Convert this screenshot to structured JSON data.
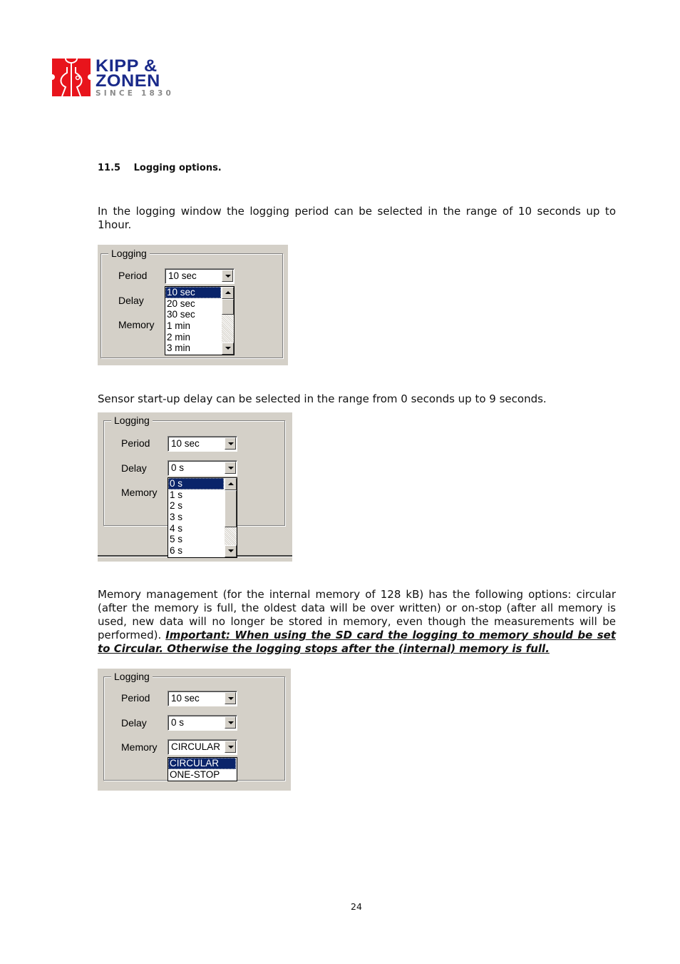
{
  "logo": {
    "line1": "KIPP &",
    "line2": "ZONEN",
    "line3": "SINCE 1830",
    "brand_red": "#e8141c",
    "brand_blue": "#1a2a8a"
  },
  "section": {
    "number": "11.5",
    "title": "Logging options."
  },
  "paragraphs": {
    "period_text": "In the logging window the logging period can be selected in the range of 10 seconds up to 1hour.",
    "delay_text": "Sensor start-up delay can be selected in the range from 0 seconds up to 9 seconds.",
    "memory_text": "Memory management (for the internal memory of 128 kB) has the following options: circular (after the memory is full, the oldest data will be over written) or on-stop (after all memory is used, new data will no longer be stored in memory, even though the measurements will be performed). ",
    "memory_important": "Important: When using the SD card the logging to memory should be set to Circular. Otherwise the logging stops after the (internal) memory is full."
  },
  "dialog_period": {
    "group_title": "Logging",
    "labels": {
      "period": "Period",
      "delay": "Delay",
      "memory": "Memory"
    },
    "period_value": "10 sec",
    "list": [
      {
        "label": "10 sec",
        "selected": true
      },
      {
        "label": "20 sec",
        "selected": false
      },
      {
        "label": "30 sec",
        "selected": false
      },
      {
        "label": "1 min",
        "selected": false
      },
      {
        "label": "2 min",
        "selected": false
      },
      {
        "label": "3 min",
        "selected": false
      }
    ]
  },
  "dialog_delay": {
    "group_title": "Logging",
    "labels": {
      "period": "Period",
      "delay": "Delay",
      "memory": "Memory"
    },
    "period_value": "10 sec",
    "delay_value": "0 s",
    "list": [
      {
        "label": "0 s",
        "selected": true
      },
      {
        "label": "1 s",
        "selected": false
      },
      {
        "label": "2 s",
        "selected": false
      },
      {
        "label": "3 s",
        "selected": false
      },
      {
        "label": "4 s",
        "selected": false
      },
      {
        "label": "5 s",
        "selected": false
      },
      {
        "label": "6 s",
        "selected": false
      }
    ]
  },
  "dialog_memory": {
    "group_title": "Logging",
    "labels": {
      "period": "Period",
      "delay": "Delay",
      "memory": "Memory"
    },
    "period_value": "10 sec",
    "delay_value": "0 s",
    "memory_value": "CIRCULAR",
    "list": [
      {
        "label": "CIRCULAR",
        "selected": true
      },
      {
        "label": "ONE-STOP",
        "selected": false
      }
    ]
  },
  "colors": {
    "dialog_bg": "#d4d0c8",
    "selection_bg": "#0a246a"
  },
  "footer": {
    "page_number": "24"
  }
}
